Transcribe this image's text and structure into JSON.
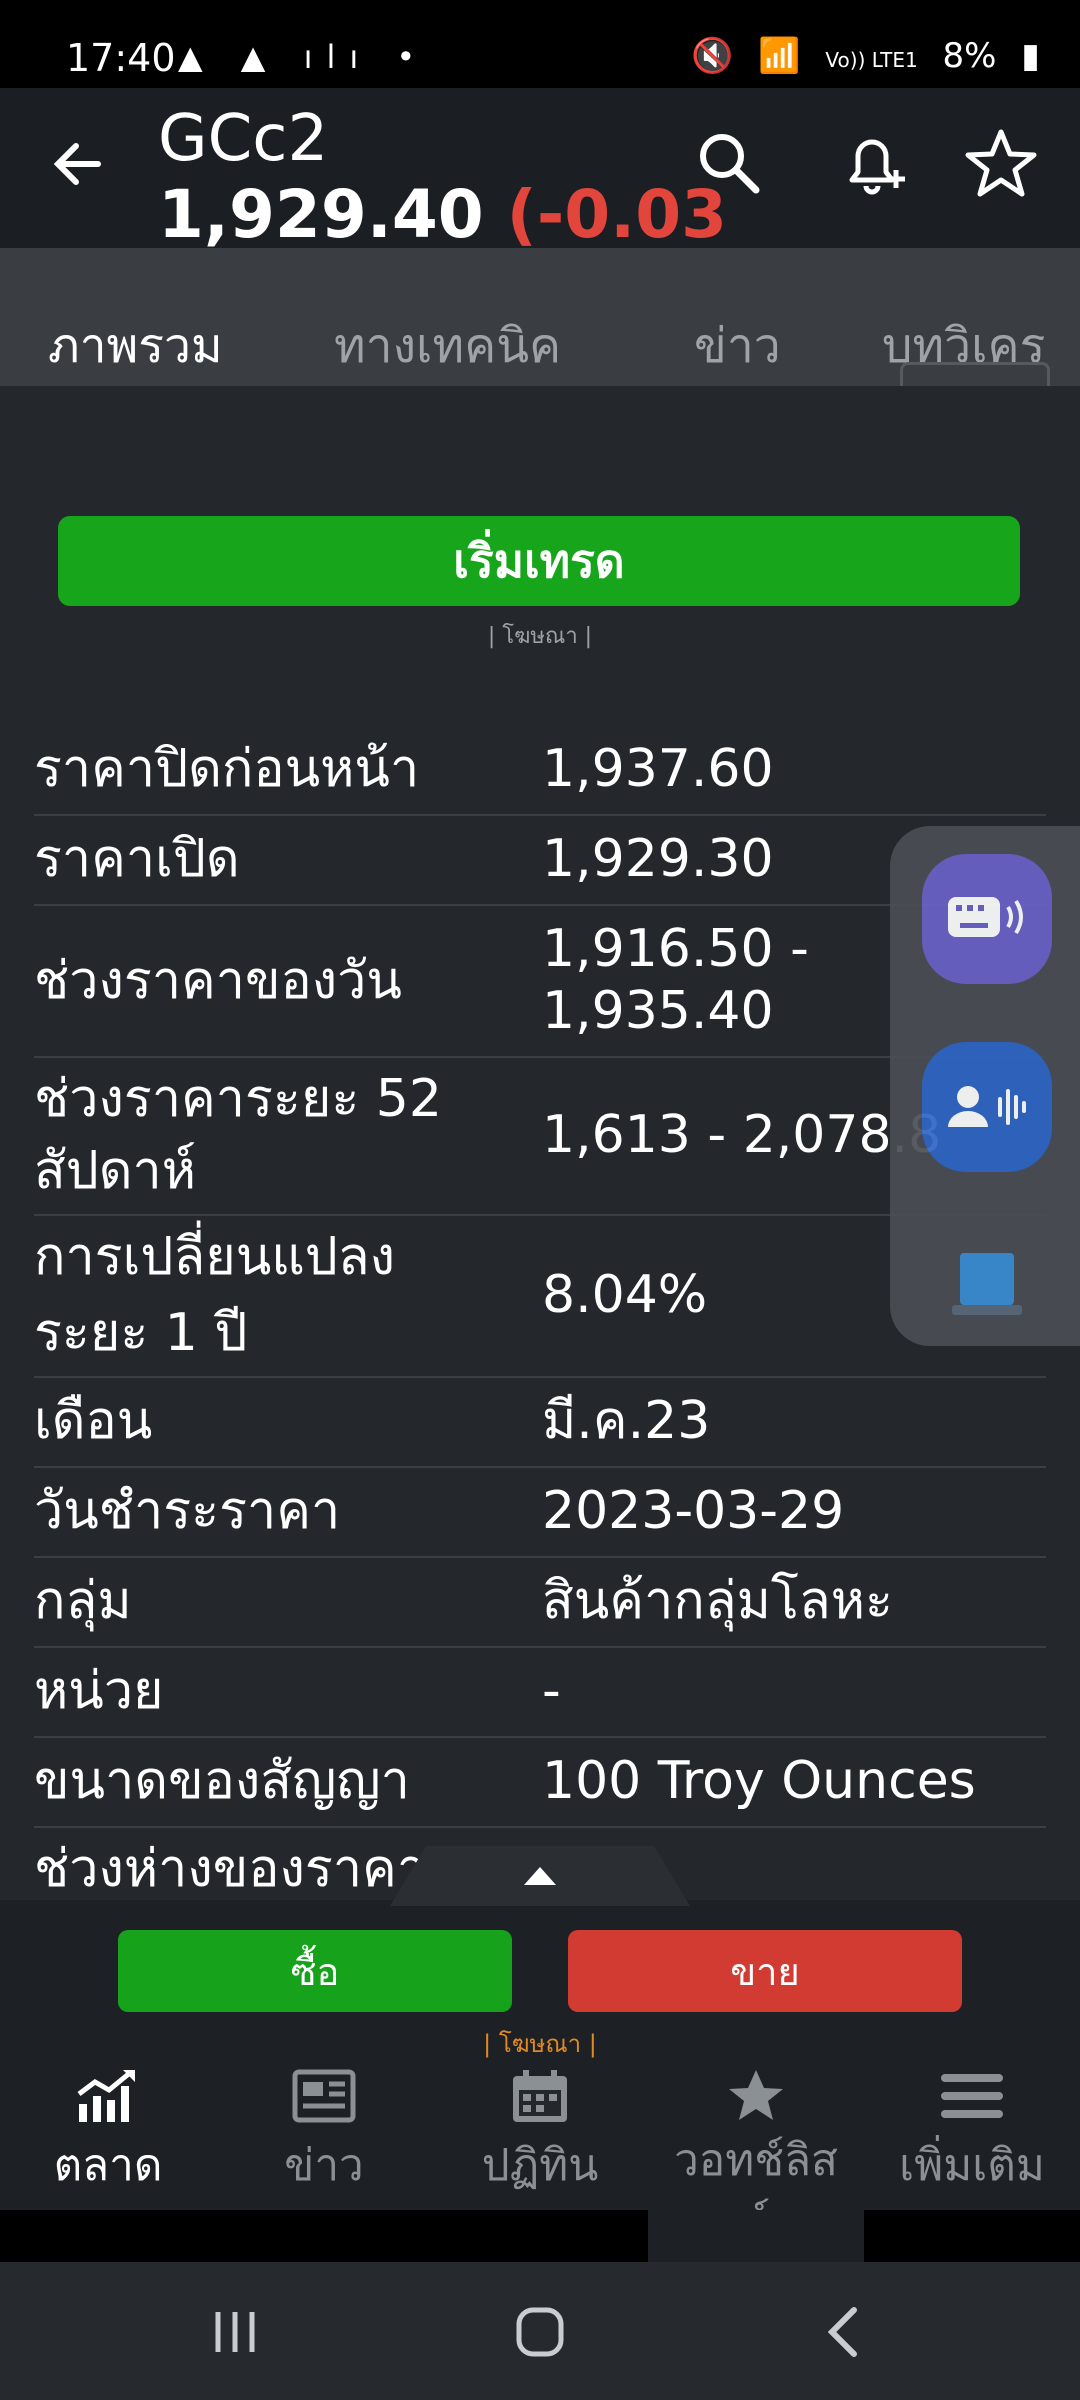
{
  "status_bar": {
    "time": "17:40",
    "left_icons": "▲ ▲ ılı •",
    "network": "Vo)) LTE1",
    "battery": "8%"
  },
  "header": {
    "symbol": "GCc2",
    "price": "1,929.40",
    "change": "(-0.03",
    "colors": {
      "change": "#e2453b"
    }
  },
  "tabs": [
    {
      "label": "ภาพรวม",
      "active": true
    },
    {
      "label": "ทางเทคนิค",
      "active": false
    },
    {
      "label": "ข่าว",
      "active": false
    },
    {
      "label": "บทวิเคร",
      "active": false
    }
  ],
  "trade_button": {
    "label": "เริ่มเทรด",
    "color": "#17a51c"
  },
  "ad_label": "| โฆษณา |",
  "info_rows": [
    {
      "label": "ราคาปิดก่อนหน้า",
      "value": "1,937.60"
    },
    {
      "label": "ราคาเปิด",
      "value": "1,929.30"
    },
    {
      "label": "ช่วงราคาของวัน",
      "value_lines": [
        "1,916.50 -",
        "1,935.40"
      ]
    },
    {
      "label_lines": [
        "ช่วงราคาระยะ 52",
        "สัปดาห์"
      ],
      "value": "1,613 - 2,078.8"
    },
    {
      "label_lines": [
        "การเปลี่ยนแปลง",
        "ระยะ 1 ปี"
      ],
      "value": "8.04%"
    },
    {
      "label": "เดือน",
      "value": "มี.ค.23"
    },
    {
      "label": "วันชำระราคา",
      "value": "2023-03-29"
    },
    {
      "label": "กลุ่ม",
      "value": "สินค้ากลุ่มโลหะ"
    },
    {
      "label": "หน่วย",
      "value": "-"
    },
    {
      "label": "ขนาดของสัญญา",
      "value": "100 Troy Ounces"
    },
    {
      "label": "ช่วงห่างของราคา",
      "value": ""
    }
  ],
  "bottom_actions": {
    "buy_label": "ซื้อ",
    "sell_label": "ขาย",
    "ad_label": "| โฆษณา |",
    "colors": {
      "buy": "#16a21b",
      "sell": "#d23b31"
    }
  },
  "bottom_nav": [
    {
      "label": "ตลาด",
      "icon": "chart-icon",
      "active": true
    },
    {
      "label": "ข่าว",
      "icon": "news-icon",
      "active": false
    },
    {
      "label": "ปฏิทิน",
      "icon": "calendar-icon",
      "active": false
    },
    {
      "label": "วอทช์ลิสต์",
      "icon": "watchlist-star-icon",
      "active": false
    },
    {
      "label": "เพิ่มเติม",
      "icon": "menu-icon",
      "active": false
    }
  ]
}
